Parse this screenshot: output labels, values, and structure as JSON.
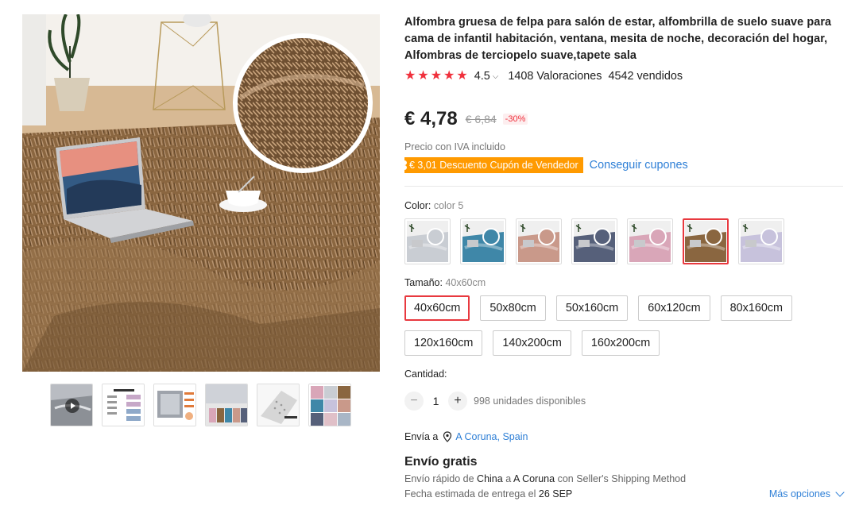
{
  "product": {
    "title": "Alfombra gruesa de felpa para salón de estar, alfombrilla de suelo suave para cama de infantil habitación, ventana, mesita de noche, decoración del hogar, Alfombras de terciopelo suave,tapete sala",
    "rating": "4.5",
    "reviews": "1408 Valoraciones",
    "sold": "4542 vendidos",
    "price": "€ 4,78",
    "original_price": "€ 6,84",
    "discount": "-30%",
    "tax_note": "Precio con IVA incluido",
    "coupon": "€ 3,01 Descuento Cupón de Vendedor",
    "coupon_link": "Conseguir cupones"
  },
  "color": {
    "label": "Color:",
    "selected": "color 5",
    "options": [
      "grey",
      "blue",
      "pink-brown",
      "dark-blue",
      "pink",
      "brown",
      "rainbow"
    ],
    "swatches": [
      "#c9cdd3",
      "#3f87a8",
      "#c9998a",
      "#56607a",
      "#d9a6b8",
      "#8a6640",
      "#c7c2dc"
    ]
  },
  "size": {
    "label": "Tamaño:",
    "selected": "40x60cm",
    "options": [
      "40x60cm",
      "50x80cm",
      "50x160cm",
      "60x120cm",
      "80x160cm",
      "120x160cm",
      "140x200cm",
      "160x200cm"
    ]
  },
  "quantity": {
    "label": "Cantidad:",
    "minus": "−",
    "value": "1",
    "plus": "+",
    "stock": "998 unidades disponibles"
  },
  "shipping": {
    "ships_to": "Envía a",
    "location": "A Coruna, Spain",
    "free": "Envío gratis",
    "line1_a": "Envío rápido de",
    "line1_origin": "China",
    "line1_b": "a",
    "line1_dest": "A Coruna",
    "line1_c": "con Seller's Shipping Method",
    "line2_a": "Fecha estimada de entrega el",
    "line2_date": "26 SEP",
    "more": "Más opciones"
  },
  "icons": {
    "star": "★",
    "rating_chevron": "chevron-down-icon",
    "location": "location-pin-icon",
    "play": "play-icon"
  },
  "colors": {
    "accent": "#e8393f",
    "link": "#2e7fd6",
    "coupon": "#ff9a00",
    "star": "#f0303c"
  }
}
